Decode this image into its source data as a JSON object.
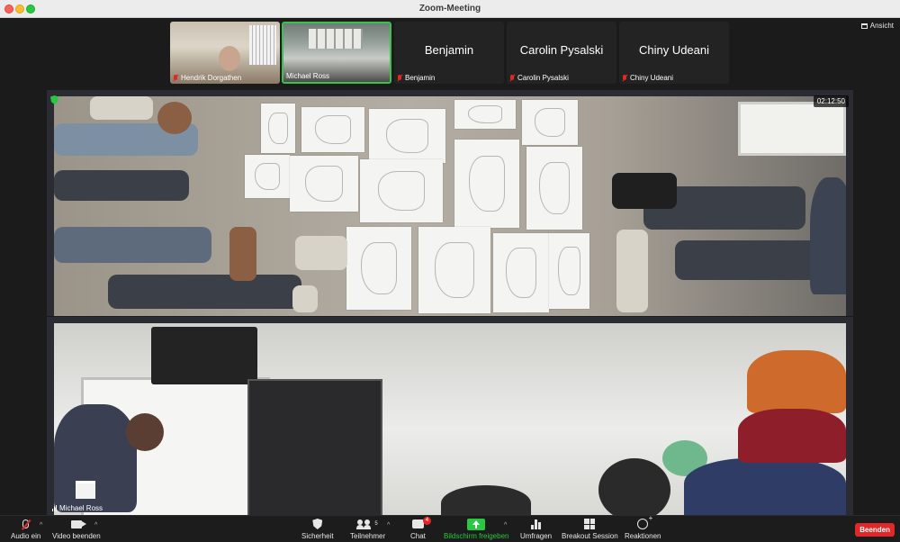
{
  "window": {
    "title": "Zoom-Meeting"
  },
  "view": {
    "label": "Ansicht"
  },
  "participants": [
    {
      "name": "Hendrik Dorgathen",
      "has_video": true
    },
    {
      "name": "Michael Ross",
      "has_video": true,
      "active": true
    },
    {
      "name": "Benjamin",
      "has_video": false
    },
    {
      "name": "Carolin Pysalski",
      "has_video": false
    },
    {
      "name": "Chiny Udeani",
      "has_video": false
    }
  ],
  "main": {
    "timer": "02:12:50",
    "bottom_name": "Michael Ross"
  },
  "toolbar": {
    "audio": "Audio ein",
    "video": "Video beenden",
    "security": "Sicherheit",
    "participants": "Teilnehmer",
    "participants_count": "5",
    "chat": "Chat",
    "chat_badge": "4",
    "share": "Bildschirm freigeben",
    "polls": "Umfragen",
    "breakout": "Breakout Session",
    "reactions": "Reaktionen",
    "end": "Beenden"
  },
  "colors": {
    "accent_green": "#28c840",
    "end_red": "#e02828",
    "active_border": "#3cc24c"
  }
}
